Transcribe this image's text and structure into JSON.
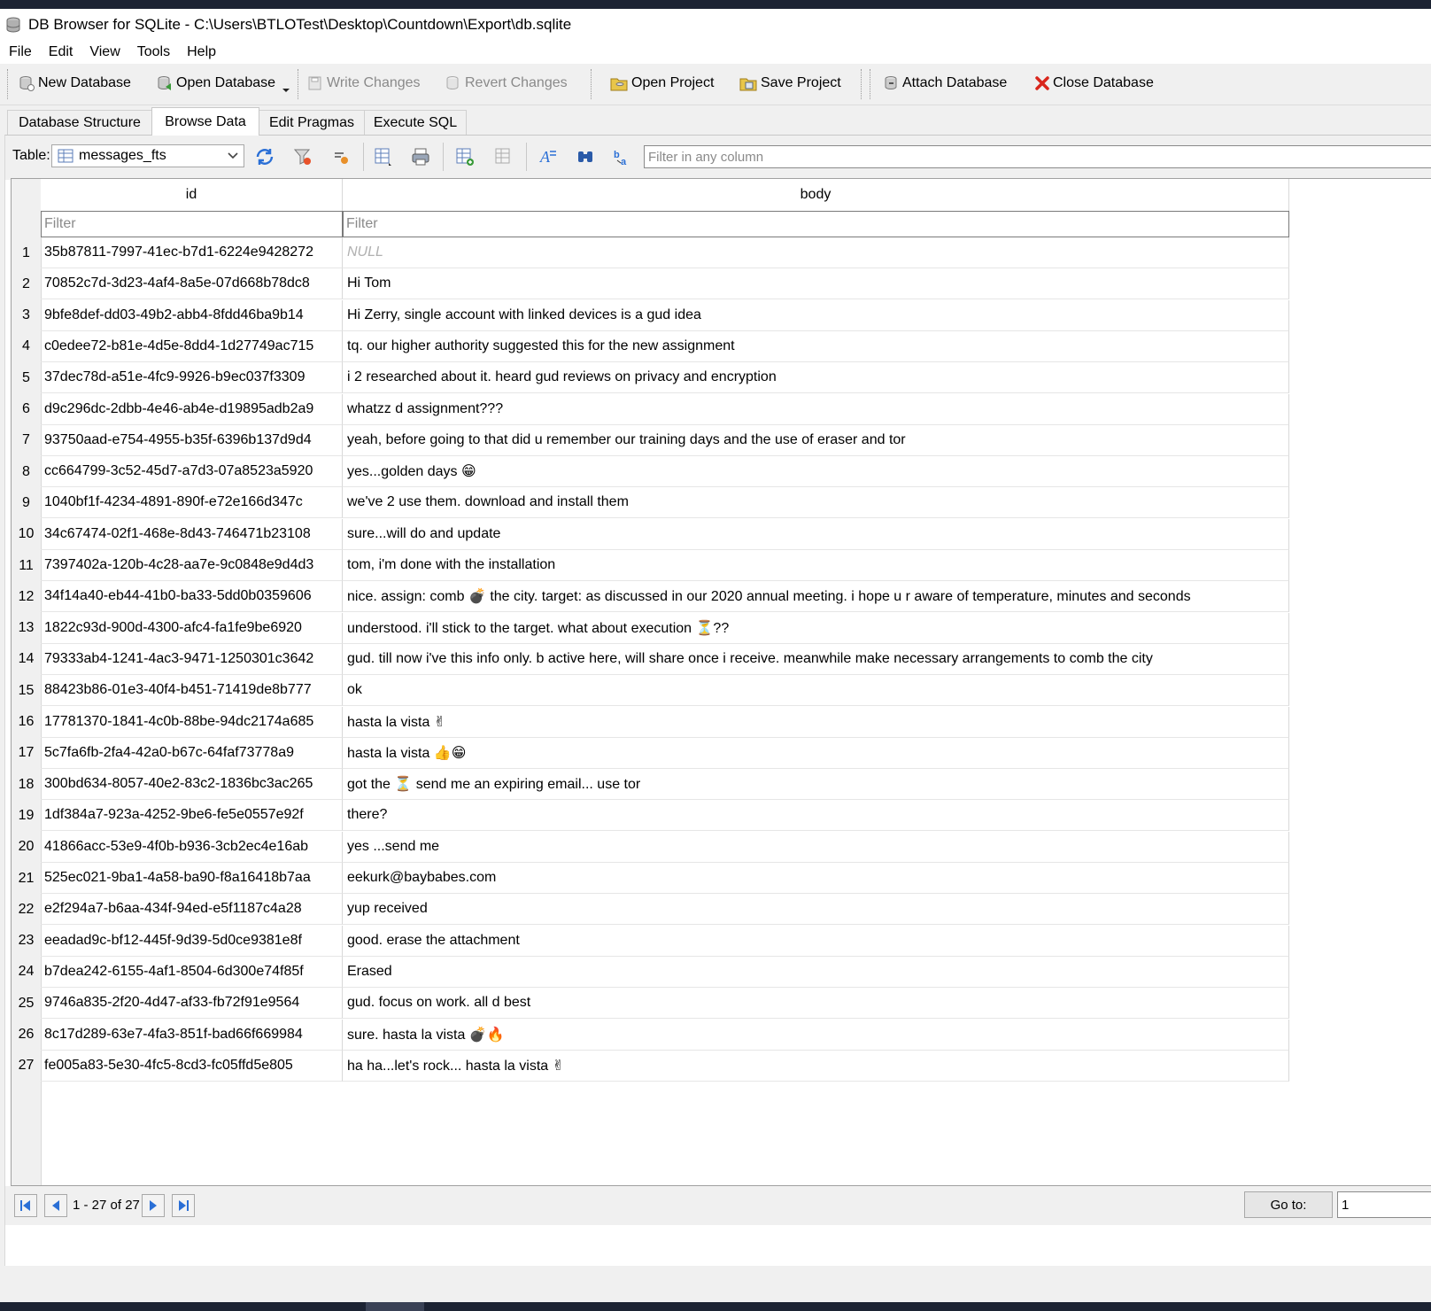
{
  "window": {
    "title": "DB Browser for SQLite - C:\\Users\\BTLOTest\\Desktop\\Countdown\\Export\\db.sqlite"
  },
  "menu": [
    "File",
    "Edit",
    "View",
    "Tools",
    "Help"
  ],
  "toolbar": {
    "new_database": "New Database",
    "open_database": "Open Database",
    "write_changes": "Write Changes",
    "revert_changes": "Revert Changes",
    "open_project": "Open Project",
    "save_project": "Save Project",
    "attach_database": "Attach Database",
    "close_database": "Close Database"
  },
  "tabs": [
    "Database Structure",
    "Browse Data",
    "Edit Pragmas",
    "Execute SQL"
  ],
  "browse": {
    "table_label": "Table:",
    "table_selected": "messages_fts",
    "filter_any_placeholder": "Filter in any column",
    "columns": [
      "id",
      "body"
    ],
    "filter_placeholder": "Filter",
    "rows": [
      {
        "n": "1",
        "id": "35b87811-7997-41ec-b7d1-6224e9428272",
        "body": "NULL",
        "null": true
      },
      {
        "n": "2",
        "id": "70852c7d-3d23-4af4-8a5e-07d668b78dc8",
        "body": "Hi Tom"
      },
      {
        "n": "3",
        "id": "9bfe8def-dd03-49b2-abb4-8fdd46ba9b14",
        "body": "Hi Zerry, single account with linked devices is a gud idea"
      },
      {
        "n": "4",
        "id": "c0edee72-b81e-4d5e-8dd4-1d27749ac715",
        "body": "tq. our higher authority suggested this for the new assignment"
      },
      {
        "n": "5",
        "id": "37dec78d-a51e-4fc9-9926-b9ec037f3309",
        "body": "i 2 researched about it. heard gud reviews on privacy and encryption"
      },
      {
        "n": "6",
        "id": "d9c296dc-2dbb-4e46-ab4e-d19895adb2a9",
        "body": "whatzz d assignment???"
      },
      {
        "n": "7",
        "id": "93750aad-e754-4955-b35f-6396b137d9d4",
        "body": "yeah, before going to that did u remember our training days and the use of eraser and tor"
      },
      {
        "n": "8",
        "id": "cc664799-3c52-45d7-a7d3-07a8523a5920",
        "body": "yes...golden days 😁"
      },
      {
        "n": "9",
        "id": "1040bf1f-4234-4891-890f-e72e166d347c",
        "body": "we've 2 use them. download and install them"
      },
      {
        "n": "10",
        "id": "34c67474-02f1-468e-8d43-746471b23108",
        "body": "sure...will do and update"
      },
      {
        "n": "11",
        "id": "7397402a-120b-4c28-aa7e-9c0848e9d4d3",
        "body": "tom, i'm done with the installation"
      },
      {
        "n": "12",
        "id": "34f14a40-eb44-41b0-ba33-5dd0b0359606",
        "body": "nice. assign: comb 💣 the city. target: as discussed in our 2020 annual meeting. i hope u r aware of temperature, minutes and seconds"
      },
      {
        "n": "13",
        "id": "1822c93d-900d-4300-afc4-fa1fe9be6920",
        "body": "understood. i'll stick to the target. what about execution ⏳??"
      },
      {
        "n": "14",
        "id": "79333ab4-1241-4ac3-9471-1250301c3642",
        "body": "gud. till now i've this info only. b active here, will share once i receive. meanwhile make necessary arrangements to comb the city"
      },
      {
        "n": "15",
        "id": "88423b86-01e3-40f4-b451-71419de8b777",
        "body": "ok"
      },
      {
        "n": "16",
        "id": "17781370-1841-4c0b-88be-94dc2174a685",
        "body": "hasta la vista ✌"
      },
      {
        "n": "17",
        "id": "5c7fa6fb-2fa4-42a0-b67c-64faf73778a9",
        "body": "hasta la vista 👍😁"
      },
      {
        "n": "18",
        "id": "300bd634-8057-40e2-83c2-1836bc3ac265",
        "body": "got the ⏳ send me an expiring email... use tor"
      },
      {
        "n": "19",
        "id": "1df384a7-923a-4252-9be6-fe5e0557e92f",
        "body": "there?"
      },
      {
        "n": "20",
        "id": "41866acc-53e9-4f0b-b936-3cb2ec4e16ab",
        "body": "yes ...send me"
      },
      {
        "n": "21",
        "id": "525ec021-9ba1-4a58-ba90-f8a16418b7aa",
        "body": "eekurk@baybabes.com"
      },
      {
        "n": "22",
        "id": "e2f294a7-b6aa-434f-94ed-e5f1187c4a28",
        "body": "yup received"
      },
      {
        "n": "23",
        "id": "eeadad9c-bf12-445f-9d39-5d0ce9381e8f",
        "body": "good. erase the attachment"
      },
      {
        "n": "24",
        "id": "b7dea242-6155-4af1-8504-6d300e74f85f",
        "body": "Erased"
      },
      {
        "n": "25",
        "id": "9746a835-2f20-4d47-af33-fb72f91e9564",
        "body": "gud. focus on work. all d best"
      },
      {
        "n": "26",
        "id": "8c17d289-63e7-4fa3-851f-bad66f669984",
        "body": "sure. hasta la vista 💣🔥"
      },
      {
        "n": "27",
        "id": "fe005a83-5e30-4fc5-8cd3-fc05ffd5e805",
        "body": "ha ha...let's rock... hasta la vista ✌"
      }
    ]
  },
  "pagination": {
    "range": "1 - 27 of 27",
    "goto_label": "Go to:",
    "goto_value": "1"
  },
  "colors": {
    "accent": "#2a6fd6",
    "close_red": "#d9261c",
    "null_text": "#b0b0b0"
  }
}
